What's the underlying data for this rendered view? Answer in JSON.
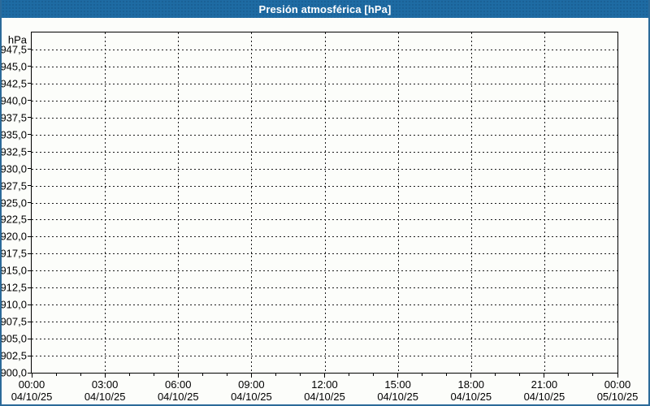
{
  "window": {
    "title": "Presión atmosférica [hPa]"
  },
  "colors": {
    "header_bg": "#1e6ba3",
    "header_text": "#ffffff",
    "panel_border": "#2b6a99",
    "plot_border": "#000000",
    "grid": "#1c1c1c",
    "content_bg": "#fcfdfa",
    "label_text": "#000000"
  },
  "chart_data": {
    "type": "line",
    "title": "Presión atmosférica [hPa]",
    "unit_label": "hPa",
    "xlabel": "",
    "ylabel": "hPa",
    "ylim": [
      900,
      950
    ],
    "y_tick_step": 2.5,
    "y_tick_values": [
      947.5,
      945.0,
      942.5,
      940.0,
      937.5,
      935.0,
      932.5,
      930.0,
      927.5,
      925.0,
      922.5,
      920.0,
      917.5,
      915.0,
      912.5,
      910.0,
      907.5,
      905.0,
      902.5,
      900.0
    ],
    "y_tick_labels": [
      "947,5",
      "945,0",
      "942,5",
      "940,0",
      "937,5",
      "935,0",
      "932,5",
      "930,0",
      "927,5",
      "925,0",
      "922,5",
      "920,0",
      "917,5",
      "915,0",
      "912,5",
      "910,0",
      "907,5",
      "905,0",
      "902,5",
      "900,0"
    ],
    "x_range_hours": 24,
    "x_major_step_hours": 3,
    "x_minor_step_hours": 1,
    "x_tick_labels": [
      {
        "time": "00:00",
        "date": "04/10/25"
      },
      {
        "time": "03:00",
        "date": "04/10/25"
      },
      {
        "time": "06:00",
        "date": "04/10/25"
      },
      {
        "time": "09:00",
        "date": "04/10/25"
      },
      {
        "time": "12:00",
        "date": "04/10/25"
      },
      {
        "time": "15:00",
        "date": "04/10/25"
      },
      {
        "time": "18:00",
        "date": "04/10/25"
      },
      {
        "time": "21:00",
        "date": "04/10/25"
      },
      {
        "time": "00:00",
        "date": "05/10/25"
      }
    ],
    "grid_style": "dashed",
    "legend_position": "none",
    "series": []
  }
}
